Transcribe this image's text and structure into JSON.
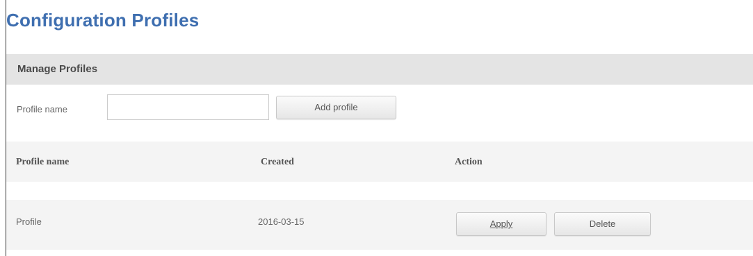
{
  "page": {
    "title": "Configuration Profiles"
  },
  "manage": {
    "header": "Manage Profiles",
    "field_label": "Profile name",
    "input_value": "",
    "add_button": "Add profile"
  },
  "table": {
    "columns": [
      "Profile name",
      "Created",
      "Action"
    ],
    "rows": [
      {
        "name": "Profile",
        "created": "2016-03-15",
        "apply_label": "Apply",
        "delete_label": "Delete"
      }
    ]
  },
  "colors": {
    "title": "#3f6fb0",
    "header_bg": "#e4e4e4",
    "row_bg": "#f4f4f4"
  }
}
